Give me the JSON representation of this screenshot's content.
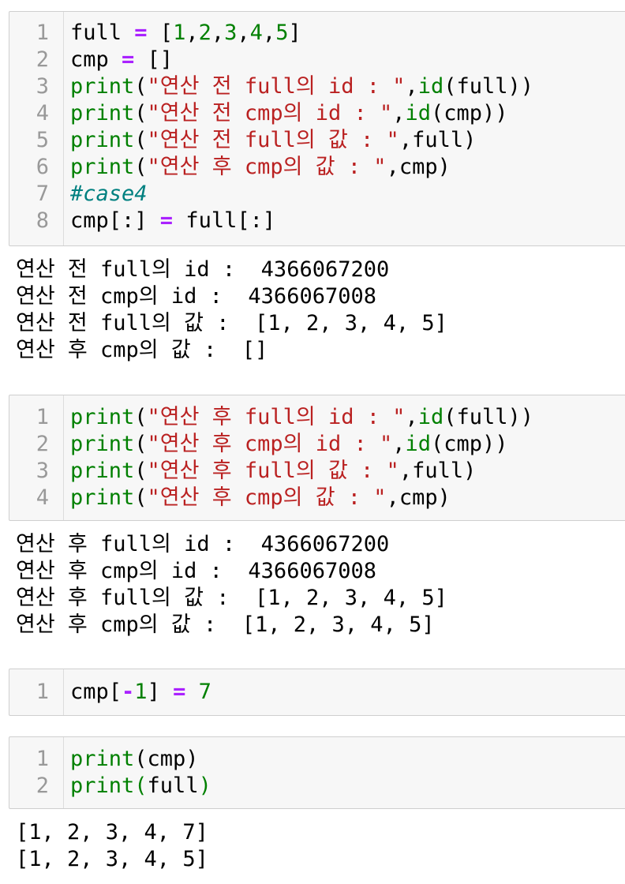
{
  "cells": [
    {
      "lines": [
        {
          "n": "1",
          "tokens": [
            {
              "t": "full ",
              "c": "pl"
            },
            {
              "t": "=",
              "c": "op"
            },
            {
              "t": " [",
              "c": "pl"
            },
            {
              "t": "1",
              "c": "num"
            },
            {
              "t": ",",
              "c": "pl"
            },
            {
              "t": "2",
              "c": "num"
            },
            {
              "t": ",",
              "c": "pl"
            },
            {
              "t": "3",
              "c": "num"
            },
            {
              "t": ",",
              "c": "pl"
            },
            {
              "t": "4",
              "c": "num"
            },
            {
              "t": ",",
              "c": "pl"
            },
            {
              "t": "5",
              "c": "num"
            },
            {
              "t": "]",
              "c": "pl"
            }
          ]
        },
        {
          "n": "2",
          "tokens": [
            {
              "t": "cmp ",
              "c": "pl"
            },
            {
              "t": "=",
              "c": "op"
            },
            {
              "t": " []",
              "c": "pl"
            }
          ]
        },
        {
          "n": "3",
          "tokens": [
            {
              "t": "print",
              "c": "kw"
            },
            {
              "t": "(",
              "c": "pl"
            },
            {
              "t": "\"연산 전 full의 id : \"",
              "c": "str"
            },
            {
              "t": ",",
              "c": "pl"
            },
            {
              "t": "id",
              "c": "kw"
            },
            {
              "t": "(full))",
              "c": "pl"
            }
          ]
        },
        {
          "n": "4",
          "tokens": [
            {
              "t": "print",
              "c": "kw"
            },
            {
              "t": "(",
              "c": "pl"
            },
            {
              "t": "\"연산 전 cmp의 id : \"",
              "c": "str"
            },
            {
              "t": ",",
              "c": "pl"
            },
            {
              "t": "id",
              "c": "kw"
            },
            {
              "t": "(cmp))",
              "c": "pl"
            }
          ]
        },
        {
          "n": "5",
          "tokens": [
            {
              "t": "print",
              "c": "kw"
            },
            {
              "t": "(",
              "c": "pl"
            },
            {
              "t": "\"연산 전 full의 값 : \"",
              "c": "str"
            },
            {
              "t": ",full)",
              "c": "pl"
            }
          ]
        },
        {
          "n": "6",
          "tokens": [
            {
              "t": "print",
              "c": "kw"
            },
            {
              "t": "(",
              "c": "pl"
            },
            {
              "t": "\"연산 후 cmp의 값 : \"",
              "c": "str"
            },
            {
              "t": ",cmp)",
              "c": "pl"
            }
          ]
        },
        {
          "n": "7",
          "tokens": [
            {
              "t": "#case4",
              "c": "cm"
            }
          ]
        },
        {
          "n": "8",
          "tokens": [
            {
              "t": "cmp[:] ",
              "c": "pl"
            },
            {
              "t": "=",
              "c": "op"
            },
            {
              "t": " full[:]",
              "c": "pl"
            }
          ]
        }
      ],
      "output": [
        "연산 전 full의 id :  4366067200",
        "연산 전 cmp의 id :  4366067008",
        "연산 전 full의 값 :  [1, 2, 3, 4, 5]",
        "연산 후 cmp의 값 :  []"
      ]
    },
    {
      "lines": [
        {
          "n": "1",
          "tokens": [
            {
              "t": "print",
              "c": "kw"
            },
            {
              "t": "(",
              "c": "pl"
            },
            {
              "t": "\"연산 후 full의 id : \"",
              "c": "str"
            },
            {
              "t": ",",
              "c": "pl"
            },
            {
              "t": "id",
              "c": "kw"
            },
            {
              "t": "(full))",
              "c": "pl"
            }
          ]
        },
        {
          "n": "2",
          "tokens": [
            {
              "t": "print",
              "c": "kw"
            },
            {
              "t": "(",
              "c": "pl"
            },
            {
              "t": "\"연산 후 cmp의 id : \"",
              "c": "str"
            },
            {
              "t": ",",
              "c": "pl"
            },
            {
              "t": "id",
              "c": "kw"
            },
            {
              "t": "(cmp))",
              "c": "pl"
            }
          ]
        },
        {
          "n": "3",
          "tokens": [
            {
              "t": "print",
              "c": "kw"
            },
            {
              "t": "(",
              "c": "pl"
            },
            {
              "t": "\"연산 후 full의 값 : \"",
              "c": "str"
            },
            {
              "t": ",full)",
              "c": "pl"
            }
          ]
        },
        {
          "n": "4",
          "tokens": [
            {
              "t": "print",
              "c": "kw"
            },
            {
              "t": "(",
              "c": "pl"
            },
            {
              "t": "\"연산 후 cmp의 값 : \"",
              "c": "str"
            },
            {
              "t": ",cmp)",
              "c": "pl"
            }
          ]
        }
      ],
      "output": [
        "연산 후 full의 id :  4366067200",
        "연산 후 cmp의 id :  4366067008",
        "연산 후 full의 값 :  [1, 2, 3, 4, 5]",
        "연산 후 cmp의 값 :  [1, 2, 3, 4, 5]"
      ]
    },
    {
      "lines": [
        {
          "n": "1",
          "tokens": [
            {
              "t": "cmp[",
              "c": "pl"
            },
            {
              "t": "-",
              "c": "op"
            },
            {
              "t": "1",
              "c": "num"
            },
            {
              "t": "] ",
              "c": "pl"
            },
            {
              "t": "=",
              "c": "op"
            },
            {
              "t": " ",
              "c": "pl"
            },
            {
              "t": "7",
              "c": "num"
            }
          ]
        }
      ],
      "output": []
    },
    {
      "lines": [
        {
          "n": "1",
          "tokens": [
            {
              "t": "print",
              "c": "kw"
            },
            {
              "t": "(cmp)",
              "c": "pl"
            }
          ]
        },
        {
          "n": "2",
          "tokens": [
            {
              "t": "print",
              "c": "kw"
            },
            {
              "t": "(",
              "c": "kw"
            },
            {
              "t": "full",
              "c": "pl"
            },
            {
              "t": ")",
              "c": "kw"
            }
          ]
        }
      ],
      "output": [
        "[1, 2, 3, 4, 7]",
        "[1, 2, 3, 4, 5]"
      ]
    }
  ]
}
